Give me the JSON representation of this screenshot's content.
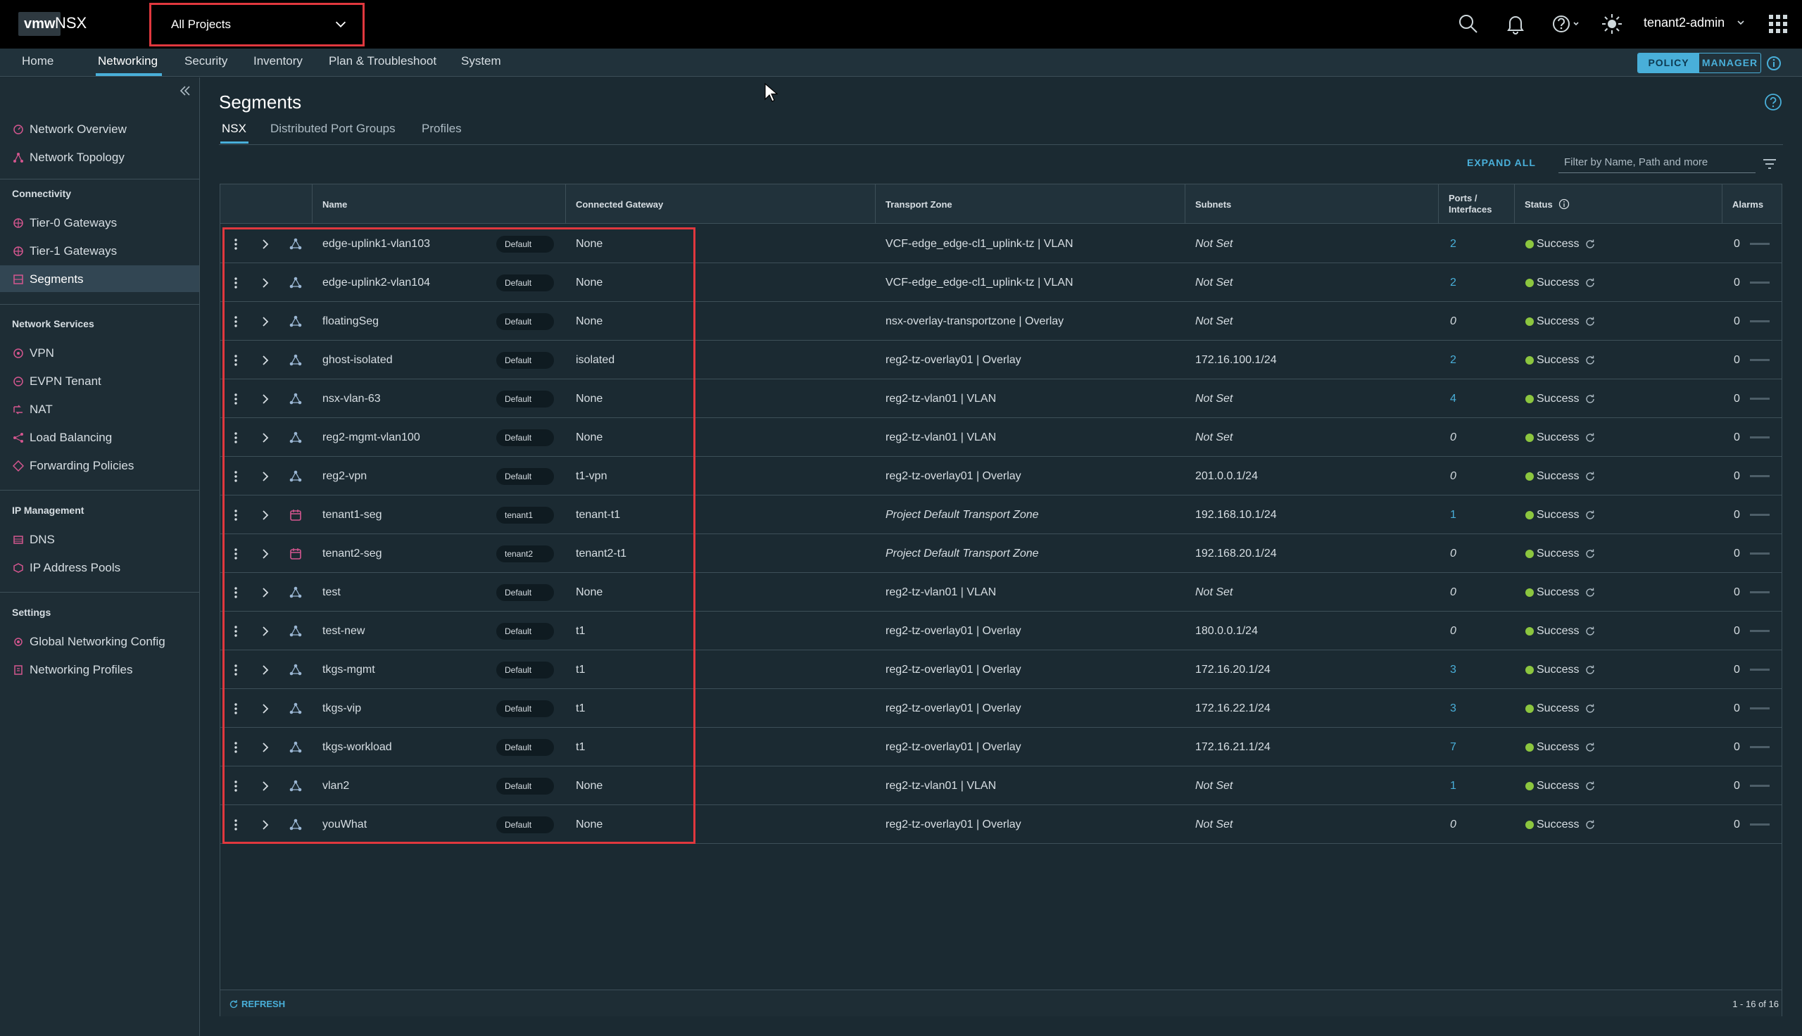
{
  "header": {
    "logo": "vmw",
    "product": "NSX",
    "project_selector": "All Projects",
    "user": "tenant2-admin",
    "icons": [
      "search-icon",
      "bell-icon",
      "help-icon",
      "theme-icon",
      "apps-grid-icon"
    ]
  },
  "nav": {
    "tabs": [
      "Home",
      "Networking",
      "Security",
      "Inventory",
      "Plan & Troubleshoot",
      "System"
    ],
    "active": "Networking",
    "mode_policy": "POLICY",
    "mode_manager": "MANAGER"
  },
  "sidebar": {
    "top_items": [
      {
        "label": "Network Overview",
        "icon": "network-overview-icon"
      },
      {
        "label": "Network Topology",
        "icon": "network-topology-icon"
      }
    ],
    "sections": [
      {
        "heading": "Connectivity",
        "items": [
          "Tier-0 Gateways",
          "Tier-1 Gateways",
          "Segments"
        ]
      },
      {
        "heading": "Network Services",
        "items": [
          "VPN",
          "EVPN Tenant",
          "NAT",
          "Load Balancing",
          "Forwarding Policies"
        ]
      },
      {
        "heading": "IP Management",
        "items": [
          "DNS",
          "IP Address Pools"
        ]
      },
      {
        "heading": "Settings",
        "items": [
          "Global Networking Config",
          "Networking Profiles"
        ]
      }
    ],
    "active": "Segments"
  },
  "main": {
    "title": "Segments",
    "subtabs": [
      "NSX",
      "Distributed Port Groups",
      "Profiles"
    ],
    "active_subtab": "NSX",
    "expand_all": "EXPAND ALL",
    "filter_placeholder": "Filter by Name, Path and more",
    "columns": [
      "Name",
      "Connected Gateway",
      "Transport Zone",
      "Subnets",
      "Ports / Interfaces",
      "Status",
      "Alarms"
    ],
    "rows": [
      {
        "name": "edge-uplink1-vlan103",
        "badge": "Default",
        "gateway": "None",
        "zone": "VCF-edge_edge-cl1_uplink-tz | VLAN",
        "subnets": "Not Set",
        "ports": "2",
        "status": "Success",
        "alarms": "0",
        "icon": "segment-icon"
      },
      {
        "name": "edge-uplink2-vlan104",
        "badge": "Default",
        "gateway": "None",
        "zone": "VCF-edge_edge-cl1_uplink-tz | VLAN",
        "subnets": "Not Set",
        "ports": "2",
        "status": "Success",
        "alarms": "0",
        "icon": "segment-icon"
      },
      {
        "name": "floatingSeg",
        "badge": "Default",
        "gateway": "None",
        "zone": "nsx-overlay-transportzone | Overlay",
        "subnets": "Not Set",
        "ports": "0",
        "status": "Success",
        "alarms": "0",
        "icon": "segment-icon"
      },
      {
        "name": "ghost-isolated",
        "badge": "Default",
        "gateway": "isolated",
        "zone": "reg2-tz-overlay01 | Overlay",
        "subnets": "172.16.100.1/24",
        "ports": "2",
        "status": "Success",
        "alarms": "0",
        "icon": "segment-icon"
      },
      {
        "name": "nsx-vlan-63",
        "badge": "Default",
        "gateway": "None",
        "zone": "reg2-tz-vlan01 | VLAN",
        "subnets": "Not Set",
        "ports": "4",
        "status": "Success",
        "alarms": "0",
        "icon": "segment-icon"
      },
      {
        "name": "reg2-mgmt-vlan100",
        "badge": "Default",
        "gateway": "None",
        "zone": "reg2-tz-vlan01 | VLAN",
        "subnets": "Not Set",
        "ports": "0",
        "status": "Success",
        "alarms": "0",
        "icon": "segment-icon"
      },
      {
        "name": "reg2-vpn",
        "badge": "Default",
        "gateway": "t1-vpn",
        "zone": "reg2-tz-overlay01 | Overlay",
        "subnets": "201.0.0.1/24",
        "ports": "0",
        "status": "Success",
        "alarms": "0",
        "icon": "segment-icon"
      },
      {
        "name": "tenant1-seg",
        "badge": "tenant1",
        "gateway": "tenant-t1",
        "zone": "Project Default Transport Zone",
        "subnets": "192.168.10.1/24",
        "ports": "1",
        "status": "Success",
        "alarms": "0",
        "icon": "project-segment-icon"
      },
      {
        "name": "tenant2-seg",
        "badge": "tenant2",
        "gateway": "tenant2-t1",
        "zone": "Project Default Transport Zone",
        "subnets": "192.168.20.1/24",
        "ports": "0",
        "status": "Success",
        "alarms": "0",
        "icon": "project-segment-icon"
      },
      {
        "name": "test",
        "badge": "Default",
        "gateway": "None",
        "zone": "reg2-tz-vlan01 | VLAN",
        "subnets": "Not Set",
        "ports": "0",
        "status": "Success",
        "alarms": "0",
        "icon": "segment-icon"
      },
      {
        "name": "test-new",
        "badge": "Default",
        "gateway": "t1",
        "zone": "reg2-tz-overlay01 | Overlay",
        "subnets": "180.0.0.1/24",
        "ports": "0",
        "status": "Success",
        "alarms": "0",
        "icon": "segment-icon"
      },
      {
        "name": "tkgs-mgmt",
        "badge": "Default",
        "gateway": "t1",
        "zone": "reg2-tz-overlay01 | Overlay",
        "subnets": "172.16.20.1/24",
        "ports": "3",
        "status": "Success",
        "alarms": "0",
        "icon": "segment-icon"
      },
      {
        "name": "tkgs-vip",
        "badge": "Default",
        "gateway": "t1",
        "zone": "reg2-tz-overlay01 | Overlay",
        "subnets": "172.16.22.1/24",
        "ports": "3",
        "status": "Success",
        "alarms": "0",
        "icon": "segment-icon"
      },
      {
        "name": "tkgs-workload",
        "badge": "Default",
        "gateway": "t1",
        "zone": "reg2-tz-overlay01 | Overlay",
        "subnets": "172.16.21.1/24",
        "ports": "7",
        "status": "Success",
        "alarms": "0",
        "icon": "segment-icon"
      },
      {
        "name": "vlan2",
        "badge": "Default",
        "gateway": "None",
        "zone": "reg2-tz-vlan01 | VLAN",
        "subnets": "Not Set",
        "ports": "1",
        "status": "Success",
        "alarms": "0",
        "icon": "segment-icon"
      },
      {
        "name": "youWhat",
        "badge": "Default",
        "gateway": "None",
        "zone": "reg2-tz-overlay01 | Overlay",
        "subnets": "Not Set",
        "ports": "0",
        "status": "Success",
        "alarms": "0",
        "icon": "segment-icon"
      }
    ],
    "refresh": "REFRESH",
    "pagination": "1 - 16 of 16"
  },
  "colors": {
    "accent": "#49afd9",
    "success": "#8cc63f",
    "highlight": "#e0383e",
    "header_bg": "#000000",
    "page_bg": "#1b2a32"
  }
}
